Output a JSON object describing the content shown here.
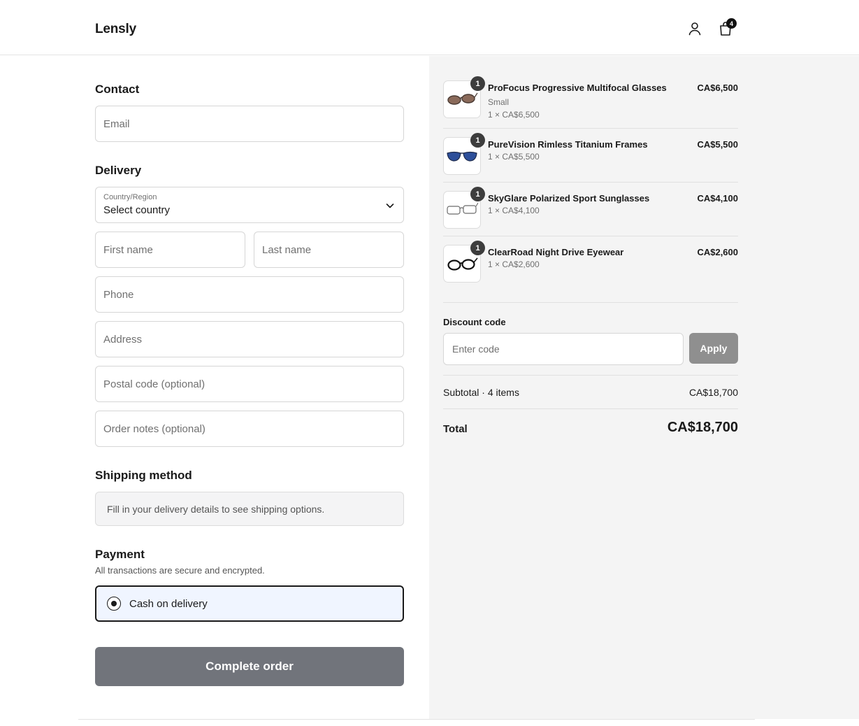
{
  "header": {
    "logo": "Lensly",
    "cart_count": "4"
  },
  "contact": {
    "title": "Contact",
    "email_placeholder": "Email"
  },
  "delivery": {
    "title": "Delivery",
    "country_label": "Country/Region",
    "country_value": "Select country",
    "first_name_placeholder": "First name",
    "last_name_placeholder": "Last name",
    "phone_placeholder": "Phone",
    "address_placeholder": "Address",
    "postal_placeholder": "Postal code (optional)",
    "notes_placeholder": "Order notes (optional)"
  },
  "shipping": {
    "title": "Shipping method",
    "note": "Fill in your delivery details to see shipping options."
  },
  "payment": {
    "title": "Payment",
    "subtitle": "All transactions are secure and encrypted.",
    "option_label": "Cash on delivery"
  },
  "complete_button": "Complete order",
  "order_summary": {
    "items": [
      {
        "name": "ProFocus Progressive Multifocal Glasses",
        "variant": "Small",
        "unit_line": "1 × CA$6,500",
        "price": "CA$6,500",
        "quantity": "1",
        "frame_color": "#4a3b34",
        "lens_color": "#8a6a5a"
      },
      {
        "name": "PureVision Rimless Titanium Frames",
        "variant": "",
        "unit_line": "1 × CA$5,500",
        "price": "CA$5,500",
        "quantity": "1",
        "frame_color": "#1d2a4a",
        "lens_color": "#2d4f9a"
      },
      {
        "name": "SkyGlare Polarized Sport Sunglasses",
        "variant": "",
        "unit_line": "1 × CA$4,100",
        "price": "CA$4,100",
        "quantity": "1",
        "frame_color": "#6b6b6b",
        "lens_color": "#ffffff"
      },
      {
        "name": "ClearRoad Night Drive Eyewear",
        "variant": "",
        "unit_line": "1 × CA$2,600",
        "price": "CA$2,600",
        "quantity": "1",
        "frame_color": "#111111",
        "lens_color": "#ffffff"
      }
    ],
    "discount_label": "Discount code",
    "discount_placeholder": "Enter code",
    "apply_label": "Apply",
    "subtotal_label": "Subtotal · 4 items",
    "subtotal_value": "CA$18,700",
    "total_label": "Total",
    "total_value": "CA$18,700"
  }
}
